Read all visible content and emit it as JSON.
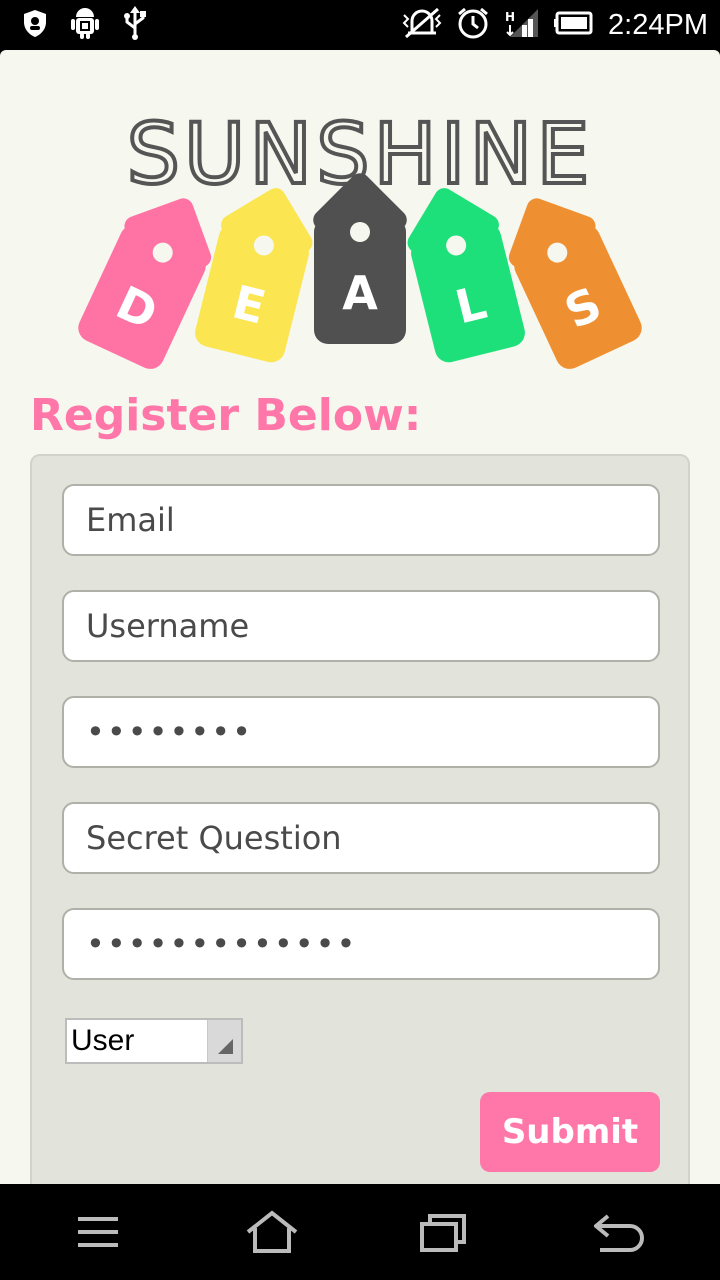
{
  "status_bar": {
    "time": "2:24PM",
    "icons": [
      "shield-icon",
      "android-debug-icon",
      "usb-icon",
      "vibrate-off-icon",
      "alarm-icon",
      "signal-icon",
      "battery-icon"
    ]
  },
  "logo": {
    "word": "SUNSHINE",
    "tags": [
      {
        "letter": "D",
        "color": "#ff73a4"
      },
      {
        "letter": "E",
        "color": "#fbe551"
      },
      {
        "letter": "A",
        "color": "#505050"
      },
      {
        "letter": "L",
        "color": "#1ee07a"
      },
      {
        "letter": "S",
        "color": "#ee9032"
      }
    ]
  },
  "form": {
    "title": "Register Below:",
    "email_placeholder": "Email",
    "username_placeholder": "Username",
    "password_value": "••••••••",
    "secret_question_placeholder": "Secret Question",
    "secret_answer_value": "•••••••••••••",
    "role_selected": "User",
    "submit_label": "Submit"
  },
  "nav_bar": {
    "buttons": [
      "menu-icon",
      "home-icon",
      "recent-apps-icon",
      "back-icon"
    ]
  },
  "colors": {
    "accent": "#ff77a8",
    "background": "#f6f7ef",
    "panel": "#e2e3db"
  }
}
